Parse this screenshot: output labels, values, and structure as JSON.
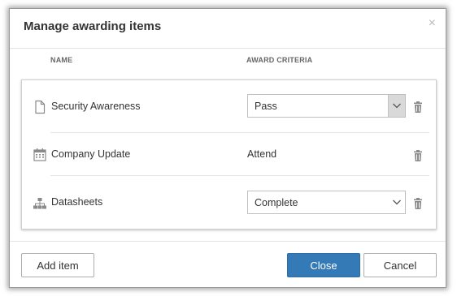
{
  "dialog": {
    "title": "Manage awarding items",
    "close_glyph": "×"
  },
  "columns": {
    "name": "NAME",
    "criteria": "AWARD CRITERIA"
  },
  "items": [
    {
      "icon": "document-icon",
      "label": "Security Awareness",
      "criteria_type": "select",
      "criteria": "Pass",
      "delete_icon": "trash-icon"
    },
    {
      "icon": "calendar-icon",
      "label": "Company Update",
      "criteria_type": "static",
      "criteria": "Attend",
      "delete_icon": "trash-icon"
    },
    {
      "icon": "sitemap-icon",
      "label": "Datasheets",
      "criteria_type": "select",
      "criteria": "Complete",
      "delete_icon": "trash-icon"
    }
  ],
  "footer": {
    "add_label": "Add item",
    "close_label": "Close",
    "cancel_label": "Cancel"
  },
  "colors": {
    "primary": "#337ab7",
    "icon_gray": "#8a8a8a",
    "border": "#bfbfbf"
  }
}
